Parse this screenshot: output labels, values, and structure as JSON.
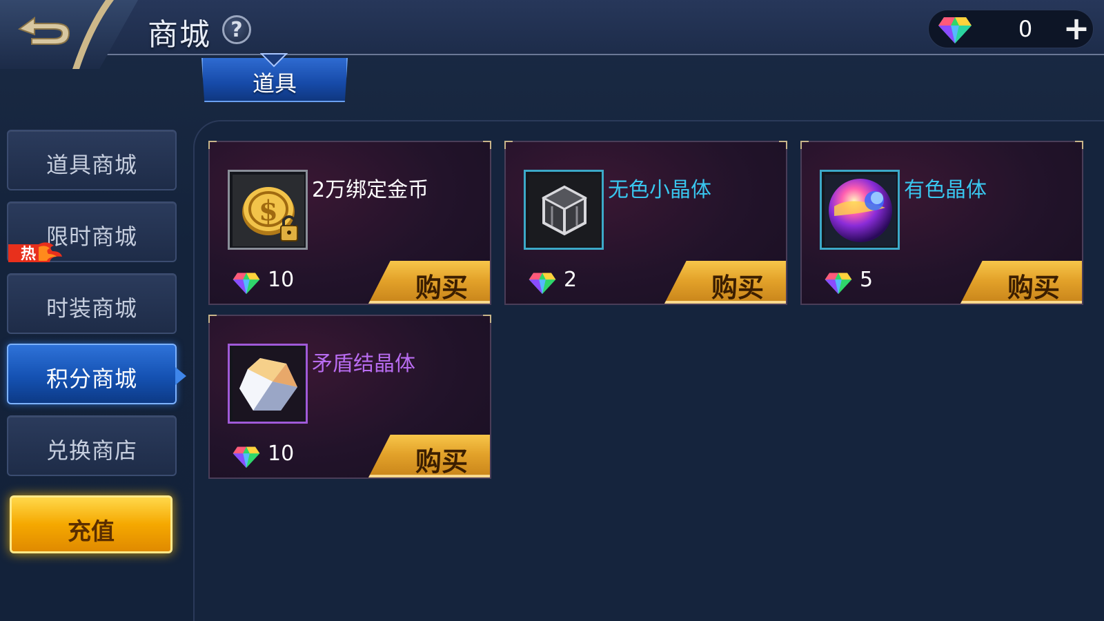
{
  "header": {
    "title": "商城",
    "help_symbol": "?",
    "currency": {
      "icon": "gem-icon",
      "value": "0",
      "add_symbol": "+"
    }
  },
  "tabs": [
    {
      "label": "道具",
      "active": true
    }
  ],
  "sidebar": {
    "items": [
      {
        "label": "道具商城",
        "active": false
      },
      {
        "label": "限时商城",
        "active": false,
        "badge": "热"
      },
      {
        "label": "时装商城",
        "active": false
      },
      {
        "label": "积分商城",
        "active": true
      },
      {
        "label": "兑换商店",
        "active": false
      }
    ],
    "recharge_label": "充值"
  },
  "items": [
    {
      "name": "2万绑定金币",
      "name_color": "#ffffff",
      "icon": "gold-coin-lock-icon",
      "price": "10",
      "buy_label": "购买"
    },
    {
      "name": "无色小晶体",
      "name_color": "#39c6ee",
      "icon": "colorless-crystal-icon",
      "price": "2",
      "buy_label": "购买"
    },
    {
      "name": "有色晶体",
      "name_color": "#39c6ee",
      "icon": "colored-crystal-orb-icon",
      "price": "5",
      "buy_label": "购买"
    },
    {
      "name": "矛盾结晶体",
      "name_color": "#b86cf0",
      "icon": "contradiction-crystal-icon",
      "price": "10",
      "buy_label": "购买"
    }
  ],
  "colors": {
    "accent_blue": "#1f5fc4",
    "buy_gold": "#e3a22a",
    "recharge_gold": "#f5a800"
  }
}
